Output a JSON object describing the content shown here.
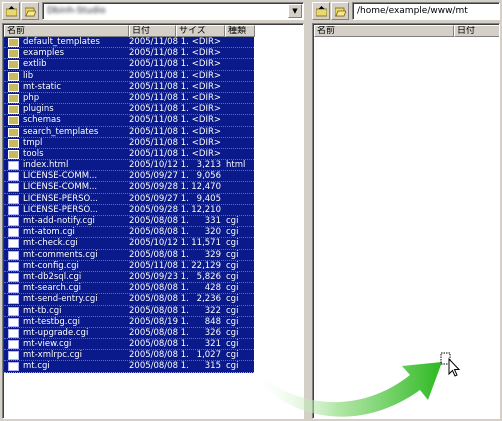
{
  "left": {
    "path": "Dbinh-Studio",
    "headers": {
      "name": "名前",
      "date": "日付",
      "size": "サイズ",
      "type": "種類"
    },
    "files": [
      {
        "kind": "folder",
        "name": "default_templates",
        "date": "2005/11/08 1...",
        "size": "<DIR>",
        "type": ""
      },
      {
        "kind": "folder",
        "name": "examples",
        "date": "2005/11/08 1...",
        "size": "<DIR>",
        "type": ""
      },
      {
        "kind": "folder",
        "name": "extlib",
        "date": "2005/11/08 1...",
        "size": "<DIR>",
        "type": ""
      },
      {
        "kind": "folder",
        "name": "lib",
        "date": "2005/11/08 1...",
        "size": "<DIR>",
        "type": ""
      },
      {
        "kind": "folder",
        "name": "mt-static",
        "date": "2005/11/08 1...",
        "size": "<DIR>",
        "type": ""
      },
      {
        "kind": "folder",
        "name": "php",
        "date": "2005/11/08 1...",
        "size": "<DIR>",
        "type": ""
      },
      {
        "kind": "folder",
        "name": "plugins",
        "date": "2005/11/08 1...",
        "size": "<DIR>",
        "type": ""
      },
      {
        "kind": "folder",
        "name": "schemas",
        "date": "2005/11/08 1...",
        "size": "<DIR>",
        "type": ""
      },
      {
        "kind": "folder",
        "name": "search_templates",
        "date": "2005/11/08 1...",
        "size": "<DIR>",
        "type": ""
      },
      {
        "kind": "folder",
        "name": "tmpl",
        "date": "2005/11/08 1...",
        "size": "<DIR>",
        "type": ""
      },
      {
        "kind": "folder",
        "name": "tools",
        "date": "2005/11/08 1...",
        "size": "<DIR>",
        "type": ""
      },
      {
        "kind": "file",
        "name": "index.html",
        "date": "2005/10/12 1...",
        "size": "3,213",
        "type": "html"
      },
      {
        "kind": "file",
        "name": "LICENSE-COMM...",
        "date": "2005/09/27 1...",
        "size": "9,056",
        "type": ""
      },
      {
        "kind": "file",
        "name": "LICENSE-COMM...",
        "date": "2005/09/28 1...",
        "size": "12,470",
        "type": ""
      },
      {
        "kind": "file",
        "name": "LICENSE-PERSO...",
        "date": "2005/09/27 1...",
        "size": "9,405",
        "type": ""
      },
      {
        "kind": "file",
        "name": "LICENSE-PERSO...",
        "date": "2005/09/28 1...",
        "size": "12,210",
        "type": ""
      },
      {
        "kind": "file",
        "name": "mt-add-notify.cgi",
        "date": "2005/08/08 1...",
        "size": "331",
        "type": "cgi"
      },
      {
        "kind": "file",
        "name": "mt-atom.cgi",
        "date": "2005/08/08 1...",
        "size": "320",
        "type": "cgi"
      },
      {
        "kind": "file",
        "name": "mt-check.cgi",
        "date": "2005/10/12 1...",
        "size": "11,571",
        "type": "cgi"
      },
      {
        "kind": "file",
        "name": "mt-comments.cgi",
        "date": "2005/08/08 1...",
        "size": "329",
        "type": "cgi"
      },
      {
        "kind": "file",
        "name": "mt-config.cgi",
        "date": "2005/11/08 1...",
        "size": "22,129",
        "type": "cgi"
      },
      {
        "kind": "file",
        "name": "mt-db2sql.cgi",
        "date": "2005/09/23 1...",
        "size": "5,826",
        "type": "cgi"
      },
      {
        "kind": "file",
        "name": "mt-search.cgi",
        "date": "2005/08/08 1...",
        "size": "428",
        "type": "cgi"
      },
      {
        "kind": "file",
        "name": "mt-send-entry.cgi",
        "date": "2005/08/08 1...",
        "size": "2,236",
        "type": "cgi"
      },
      {
        "kind": "file",
        "name": "mt-tb.cgi",
        "date": "2005/08/08 1...",
        "size": "322",
        "type": "cgi"
      },
      {
        "kind": "file",
        "name": "mt-testbg.cgi",
        "date": "2005/08/19 1...",
        "size": "848",
        "type": "cgi"
      },
      {
        "kind": "file",
        "name": "mt-upgrade.cgi",
        "date": "2005/08/08 1...",
        "size": "326",
        "type": "cgi"
      },
      {
        "kind": "file",
        "name": "mt-view.cgi",
        "date": "2005/08/08 1...",
        "size": "321",
        "type": "cgi"
      },
      {
        "kind": "file",
        "name": "mt-xmlrpc.cgi",
        "date": "2005/08/08 1...",
        "size": "1,027",
        "type": "cgi"
      },
      {
        "kind": "file",
        "name": "mt.cgi",
        "date": "2005/08/08 1...",
        "size": "315",
        "type": "cgi"
      }
    ]
  },
  "right": {
    "path": "/home/example/www/mt",
    "headers": {
      "name": "名前",
      "date": "日付"
    }
  },
  "colors": {
    "selection": "#0a1a8a",
    "arrow": "#2bb820"
  },
  "icons": {
    "folder": "folder-icon",
    "file": "file-icon",
    "up": "up-folder-icon",
    "open": "open-folder-icon"
  }
}
